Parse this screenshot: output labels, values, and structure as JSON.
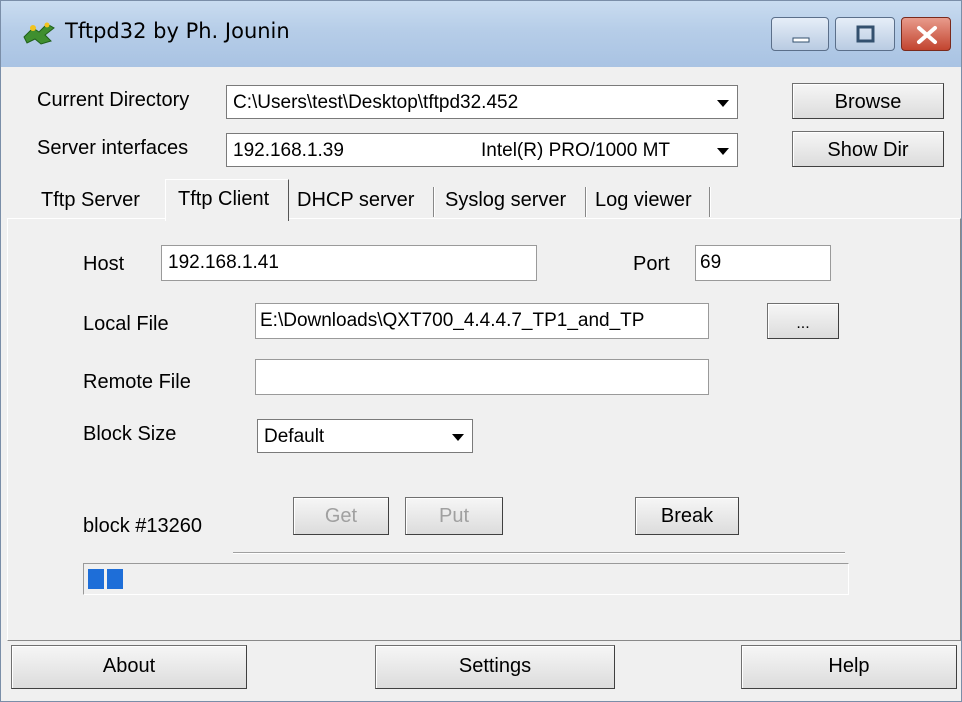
{
  "window": {
    "title": "Tftpd32 by Ph. Jounin",
    "controls": [
      "minimize-icon",
      "maximize-icon",
      "close-icon"
    ]
  },
  "top": {
    "current_directory_label": "Current Directory",
    "current_directory_value": "C:\\Users\\test\\Desktop\\tftpd32.452",
    "browse_label": "Browse",
    "server_interfaces_label": "Server interfaces",
    "server_ip": "192.168.1.39",
    "server_adapter": "Intel(R) PRO/1000 MT",
    "show_dir_label": "Show Dir"
  },
  "tabs": [
    {
      "label": "Tftp Server"
    },
    {
      "label": "Tftp Client",
      "active": true
    },
    {
      "label": "DHCP server"
    },
    {
      "label": "Syslog server"
    },
    {
      "label": "Log viewer"
    }
  ],
  "client": {
    "host_label": "Host",
    "host_value": "192.168.1.41",
    "port_label": "Port",
    "port_value": "69",
    "local_file_label": "Local File",
    "local_file_value": "E:\\Downloads\\QXT700_4.4.4.7_TP1_and_TP",
    "browse_dots_label": "...",
    "remote_file_label": "Remote File",
    "remote_file_value": "",
    "block_size_label": "Block Size",
    "block_size_value": "Default",
    "status_text": "block #13260",
    "get_label": "Get",
    "put_label": "Put",
    "break_label": "Break",
    "progress_blocks": 2
  },
  "bottom": {
    "about_label": "About",
    "settings_label": "Settings",
    "help_label": "Help"
  },
  "colors": {
    "titlebar": "#b6cde8",
    "progress": "#1e6ed8",
    "close_button": "#c2442f"
  }
}
